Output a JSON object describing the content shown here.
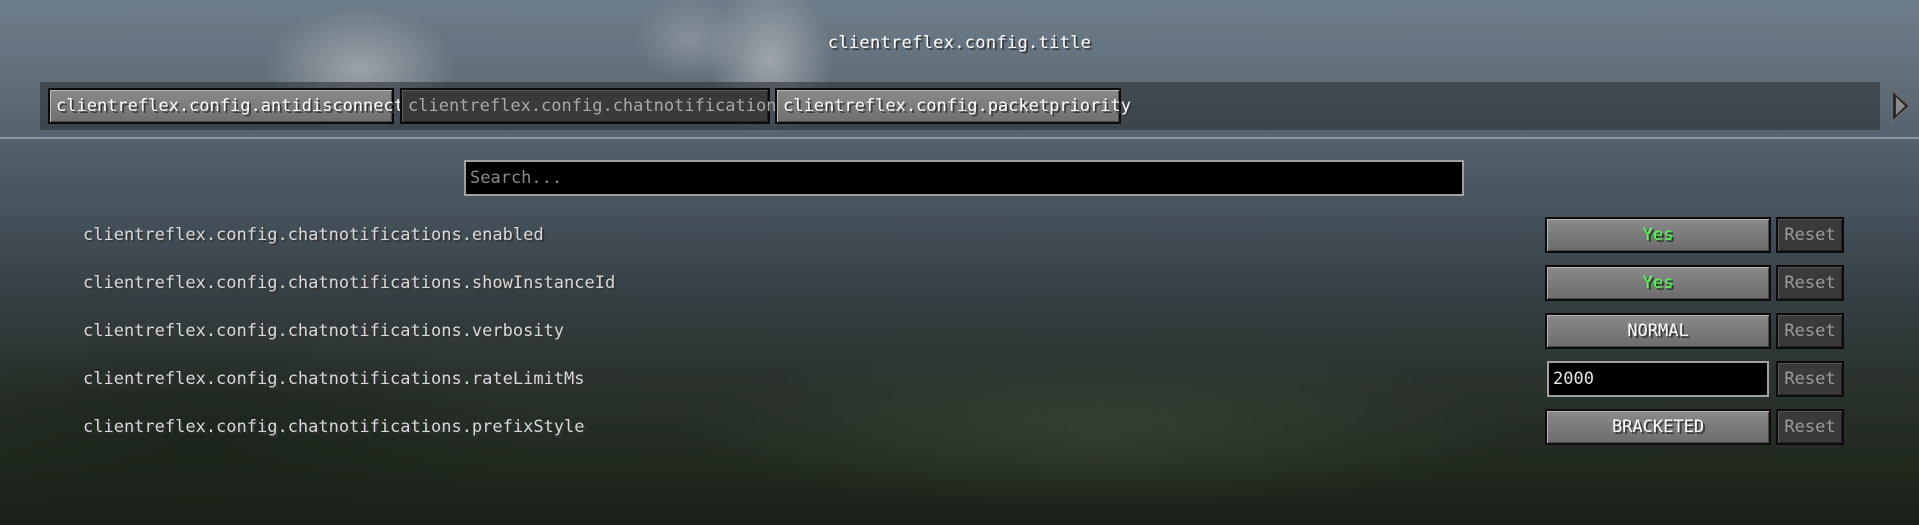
{
  "title": "clientreflex.config.title",
  "tabs": [
    {
      "label": "clientreflex.config.antidisconnect",
      "state": "active"
    },
    {
      "label": "clientreflex.config.chatnotifications",
      "state": "selected"
    },
    {
      "label": "clientreflex.config.packetpriority",
      "state": "active"
    }
  ],
  "tab_scroll_icon": "arrow-right-icon",
  "search": {
    "placeholder": "Search...",
    "value": ""
  },
  "options": [
    {
      "label": "clientreflex.config.chatnotifications.enabled",
      "value": "Yes",
      "type": "toggle",
      "reset": "Reset"
    },
    {
      "label": "clientreflex.config.chatnotifications.showInstanceId",
      "value": "Yes",
      "type": "toggle",
      "reset": "Reset"
    },
    {
      "label": "clientreflex.config.chatnotifications.verbosity",
      "value": "NORMAL",
      "type": "enum",
      "reset": "Reset"
    },
    {
      "label": "clientreflex.config.chatnotifications.rateLimitMs",
      "value": "2000",
      "type": "number",
      "reset": "Reset"
    },
    {
      "label": "clientreflex.config.chatnotifications.prefixStyle",
      "value": "BRACKETED",
      "type": "enum",
      "reset": "Reset"
    }
  ],
  "colors": {
    "yes_text": "#55ff55",
    "button_face": "#7a7a7a",
    "text_field_bg": "#000000",
    "reset_face": "#3a3a3a"
  }
}
